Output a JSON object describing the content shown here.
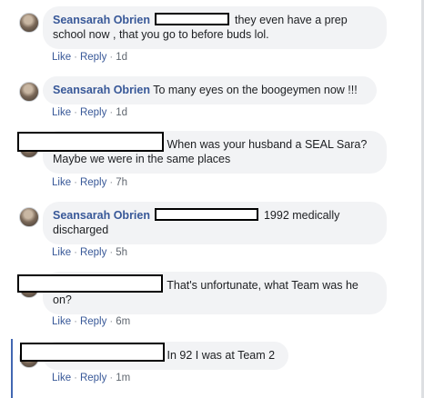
{
  "comments": [
    {
      "author": "Seansarah Obrien",
      "text": "they even have a prep school now , that you go to before buds lol.",
      "actions": {
        "like": "Like",
        "reply": "Reply",
        "time": "1d"
      }
    },
    {
      "author": "Seansarah Obrien",
      "text": "To many eyes on the boogeymen now !!!",
      "actions": {
        "like": "Like",
        "reply": "Reply",
        "time": "1d"
      }
    },
    {
      "text": "When was your husband a SEAL Sara? Maybe we were in the same places",
      "actions": {
        "like": "Like",
        "reply": "Reply",
        "time": "7h"
      }
    },
    {
      "author": "Seansarah Obrien",
      "text": "1992 medically discharged",
      "actions": {
        "like": "Like",
        "reply": "Reply",
        "time": "5h"
      }
    },
    {
      "text": "That's unfortunate, what Team was he on?",
      "actions": {
        "like": "Like",
        "reply": "Reply",
        "time": "6m"
      }
    },
    {
      "text": "In 92 I was at Team 2",
      "actions": {
        "like": "Like",
        "reply": "Reply",
        "time": "1m"
      }
    }
  ],
  "colors": {
    "author": "#385898",
    "bubble": "#f2f3f5",
    "meta": "#606770",
    "thread": "#4267b2"
  }
}
